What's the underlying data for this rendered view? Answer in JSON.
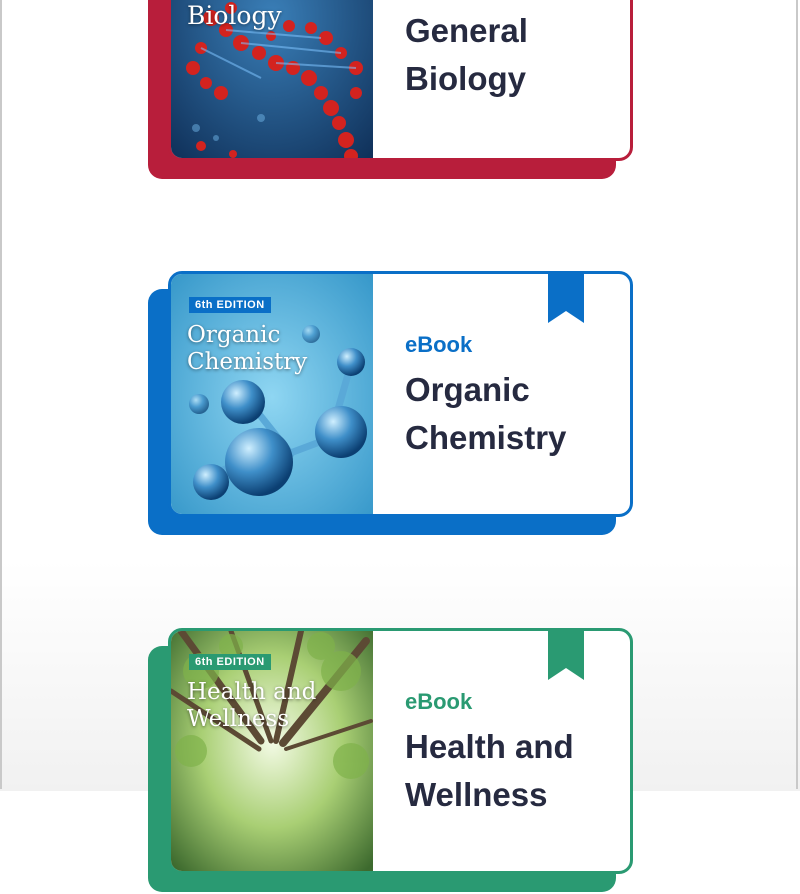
{
  "colors": {
    "biology_red": "#b81e3b",
    "chemistry_blue": "#0a6fc7",
    "wellness_green": "#2a9a72",
    "title_navy": "#262a40"
  },
  "cards": {
    "general_biology": {
      "cover_title": "Biology",
      "title": "General Biology"
    },
    "organic_chemistry": {
      "edition": "6th EDITION",
      "cover_title": "Organic Chemistry",
      "kind": "eBook",
      "title": "Organic Chemistry",
      "icon": "bookmark-icon"
    },
    "health_wellness": {
      "edition": "6th EDITION",
      "cover_title": "Health and Wellness",
      "kind": "eBook",
      "title": "Health and Wellness",
      "icon": "bookmark-icon"
    }
  }
}
